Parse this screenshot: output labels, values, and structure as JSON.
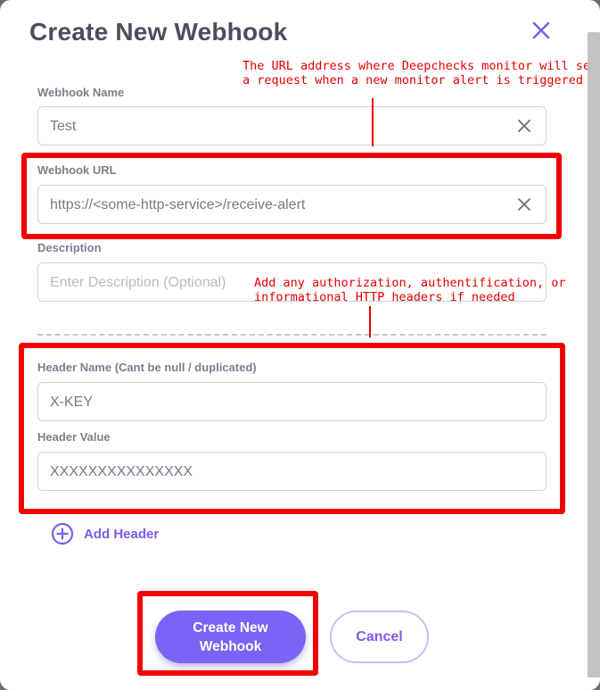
{
  "dialog": {
    "title": "Create New Webhook",
    "close_icon": "close-icon"
  },
  "fields": {
    "name": {
      "label": "Webhook Name",
      "value": "Test"
    },
    "url": {
      "label": "Webhook URL",
      "value": "https://<some-http-service>/receive-alert"
    },
    "description": {
      "label": "Description",
      "placeholder": "Enter Description (Optional)"
    },
    "header_name": {
      "label": "Header Name (Cant be null / duplicated)",
      "value": "X-KEY"
    },
    "header_value": {
      "label": "Header Value",
      "value": "XXXXXXXXXXXXXXX"
    }
  },
  "add_header_label": "Add Header",
  "buttons": {
    "create_line1": "Create New",
    "create_line2": "Webhook",
    "cancel": "Cancel"
  },
  "annotations": {
    "url_note_line1": "The URL address where Deepchecks monitor will send",
    "url_note_line2": "a request when a new monitor alert is triggered",
    "headers_note_line1": "Add any authorization, authentification, or",
    "headers_note_line2": "informational HTTP headers if needed"
  },
  "colors": {
    "accent": "#7b63f5",
    "annotation_red": "#f30000",
    "title": "#4a4f5e"
  }
}
